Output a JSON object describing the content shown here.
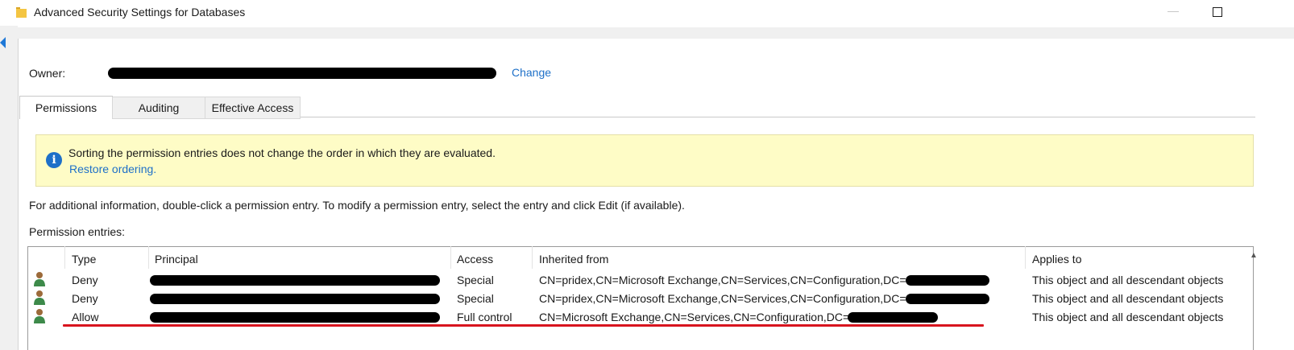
{
  "window": {
    "title": "Advanced Security Settings for Databases",
    "icon": "folder-icon",
    "min_icon": "minimize-icon",
    "max_icon": "maximize-icon"
  },
  "owner": {
    "label": "Owner:",
    "change_label": "Change"
  },
  "tabs": [
    {
      "label": "Permissions",
      "active": true
    },
    {
      "label": "Auditing",
      "active": false
    },
    {
      "label": "Effective Access",
      "active": false
    }
  ],
  "info": {
    "icon": "info-icon",
    "message": "Sorting the permission entries does not change the order in which they are evaluated.",
    "restore_label": "Restore ordering."
  },
  "help_text": "For additional information, double-click a permission entry. To modify a permission entry, select the entry and click Edit (if available).",
  "entries_label": "Permission entries:",
  "table": {
    "columns": [
      "Type",
      "Principal",
      "Access",
      "Inherited from",
      "Applies to"
    ],
    "rows": [
      {
        "type": "Deny",
        "access": "Special",
        "inherited": "CN=pridex,CN=Microsoft Exchange,CN=Services,CN=Configuration,DC=",
        "applies": "This object and all descendant objects"
      },
      {
        "type": "Deny",
        "access": "Special",
        "inherited": "CN=pridex,CN=Microsoft Exchange,CN=Services,CN=Configuration,DC=",
        "applies": "This object and all descendant objects"
      },
      {
        "type": "Allow",
        "access": "Full control",
        "inherited": "CN=Microsoft Exchange,CN=Services,CN=Configuration,DC=",
        "applies": "This object and all descendant objects"
      }
    ]
  },
  "colors": {
    "link": "#1e70c8",
    "info_bg": "#fefcc6",
    "annotation_underline": "#d8141e"
  }
}
